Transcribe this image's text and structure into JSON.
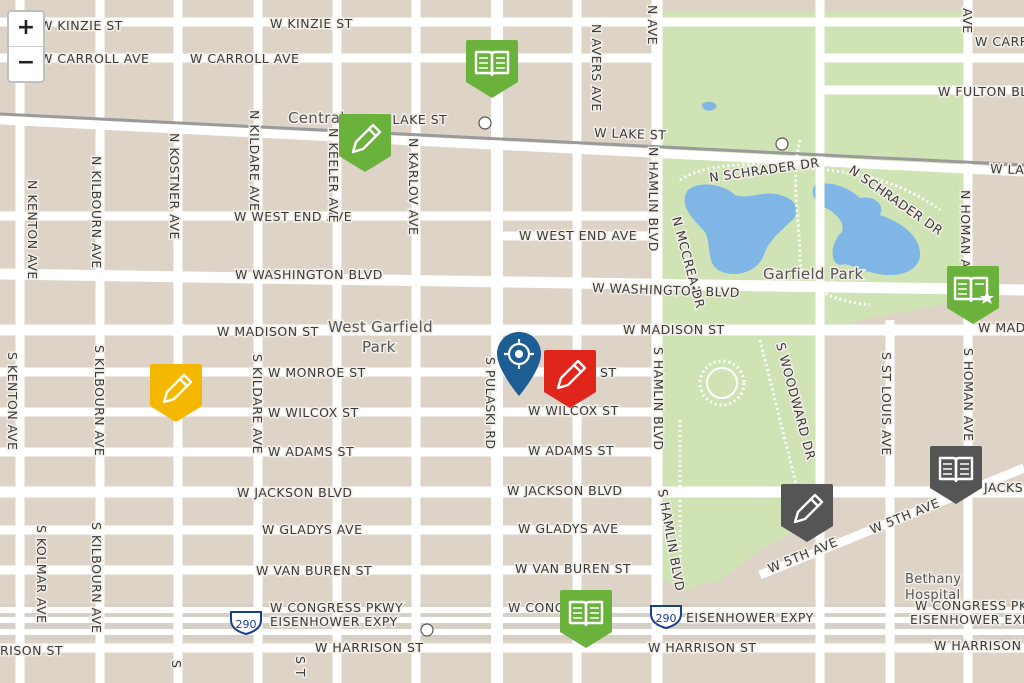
{
  "zoom": {
    "in_label": "+",
    "out_label": "−"
  },
  "colors": {
    "background": "#e9e3d8",
    "block": "#ddd3c6",
    "street": "#ffffff",
    "park": "#cfe3b5",
    "water": "#7fb6e6",
    "marker_green": "#6ab23c",
    "marker_yellow": "#f5b800",
    "marker_red": "#e0251b",
    "marker_gray": "#555555",
    "marker_blue": "#1d5e95"
  },
  "labels": {
    "kinzie_w": "W KINZIE ST",
    "kinzie_e": "W KINZIE ST",
    "carroll_w": "W CARROLL AVE",
    "carroll_e": "W CARROLL AVE",
    "fulton": "W FULTON BLVD",
    "central": "Central",
    "lake_w": "W LAKE ST",
    "lake_mid": "W LAKE ST",
    "lake_e": "W LAKE ST",
    "west_end_w": "W WEST END AVE",
    "west_end_e": "W WEST END AVE",
    "washington_w": "W WASHINGTON BLVD",
    "washington_e": "W WASHINGTON BLVD",
    "madison_w": "W MADISON ST",
    "madison_e": "W MADISON ST",
    "madison_far": "W MAD",
    "west_garfield_1": "West Garfield",
    "west_garfield_2": "Park",
    "monroe": "W MONROE ST",
    "monroe_st": "ST",
    "wilcox_w": "W WILCOX ST",
    "wilcox_e": "W WILCOX ST",
    "adams_w": "W ADAMS ST",
    "adams_e": "W ADAMS ST",
    "jackson_w": "W JACKSON BLVD",
    "jackson_e": "W JACKSON BLVD",
    "jackson_far": "JACKS",
    "gladys_w": "W GLADYS AVE",
    "gladys_e": "W GLADYS AVE",
    "vanburen_w": "W VAN BUREN ST",
    "vanburen_e": "W VAN BUREN ST",
    "congress_w": "W CONGRESS PKWY",
    "congress_e": "W CONGRESS PKWY",
    "congress_mid": "W CONG",
    "eisen_w": "EISENHOWER EXPY",
    "eisen_e": "EISENHOWER EXPY",
    "eisen_far": "EISENHOWER EXPY",
    "harrison_w": "W HARRISON ST",
    "harrison_e": "W HARRISON ST",
    "harrison_far": "W HARRISON",
    "harrison_left": "RISON ST",
    "i290_a": "290",
    "i290_b": "290",
    "fifth_a": "W 5TH AVE",
    "fifth_b": "W 5TH AVE",
    "bethany_1": "Bethany",
    "bethany_2": "Hospital",
    "garfield_park": "Garfield Park",
    "schrader_a": "N SCHRADER DR",
    "schrader_b": "N SCHRADER DR",
    "mccrea": "N MCCREA DR",
    "woodward": "S WOODWARD DR",
    "kenton_n": "N KENTON AVE",
    "kenton_s": "S KENTON AVE",
    "kilbourn_n": "N KILBOURN AVE",
    "kilbourn_s": "S KILBOURN AVE",
    "kostner_n": "N KOSTNER AVE",
    "kildare_n": "N KILDARE AVE",
    "kildare_s": "S KILDARE AVE",
    "keeler_n": "N KEELER AVE",
    "karlov_n": "N KARLOV AVE",
    "pulaski_s": "S PULASKI RD",
    "avers_n": "N AVERS AVE",
    "hamlin_n": "N HAMLIN BLVD",
    "hamlin_s_a": "S HAMLIN BLVD",
    "hamlin_s_b": "S HAMLIN BLVD",
    "hamlin_top": "N AVE",
    "stlouis_s": "S ST LOUIS AVE",
    "homan_n": "N HOMAN AVE",
    "homan_s": "S HOMAN AVE",
    "homan_top": "AVE",
    "kolmar_s": "S KOLMAR AVE",
    "s_frag": "S",
    "s_frag2": "S T"
  },
  "markers": [
    {
      "name": "marker-book-green-north",
      "icon": "book-icon",
      "color": "green"
    },
    {
      "name": "marker-pencil-green-keeler",
      "icon": "pencil-icon",
      "color": "green"
    },
    {
      "name": "marker-book-star-green-park",
      "icon": "book-star-icon",
      "color": "green"
    },
    {
      "name": "marker-pencil-yellow-kostner",
      "icon": "pencil-icon",
      "color": "yellow"
    },
    {
      "name": "marker-location-blue-pulaski",
      "icon": "crosshair-icon",
      "color": "blue"
    },
    {
      "name": "marker-pencil-red-wilcox",
      "icon": "pencil-icon",
      "color": "red"
    },
    {
      "name": "marker-pencil-gray-jackson",
      "icon": "pencil-icon",
      "color": "gray"
    },
    {
      "name": "marker-book-gray-homan",
      "icon": "book-icon",
      "color": "gray"
    },
    {
      "name": "marker-book-green-congress",
      "icon": "book-icon",
      "color": "green"
    }
  ]
}
